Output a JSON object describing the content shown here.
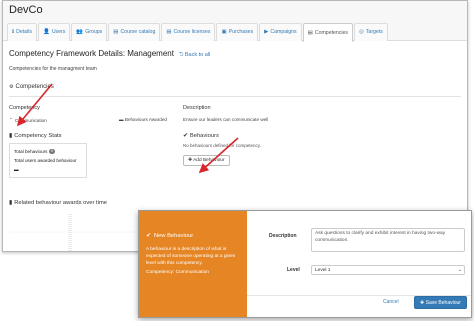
{
  "app": {
    "org_name": "DevCo"
  },
  "tabs": [
    {
      "label": "Details",
      "icon": "info-icon",
      "glyph": "ℹ"
    },
    {
      "label": "Users",
      "icon": "user-icon",
      "glyph": "👤"
    },
    {
      "label": "Groups",
      "icon": "group-icon",
      "glyph": "👥"
    },
    {
      "label": "Course catalog",
      "icon": "catalog-icon",
      "glyph": "▤"
    },
    {
      "label": "Course licenses",
      "icon": "license-icon",
      "glyph": "▤"
    },
    {
      "label": "Purchases",
      "icon": "purchase-icon",
      "glyph": "▣"
    },
    {
      "label": "Campaigns",
      "icon": "campaign-icon",
      "glyph": "▶"
    },
    {
      "label": "Competencies",
      "icon": "competency-icon",
      "glyph": "▤",
      "active": true
    },
    {
      "label": "Targets",
      "icon": "target-icon",
      "glyph": "◎"
    }
  ],
  "page": {
    "title": "Competency Framework Details: Management",
    "back_link": "Back to all",
    "subtitle": "Competencies for the managment team",
    "competencies_heading": "Competencies"
  },
  "table": {
    "col_competency": "Competency",
    "col_description": "Description",
    "row": {
      "name": "Communication",
      "awarded": "Behaviours Awarded",
      "description": "Ensure our leaders can communicate well"
    }
  },
  "stats": {
    "heading": "Competency Stats",
    "total_behaviours_label": "Total behaviours",
    "total_behaviours_count": "0",
    "total_users_label": "Total users awarded behaviour"
  },
  "behaviours": {
    "heading": "Behaviours",
    "empty_text": "No behaviours defined for competency.",
    "add_button": "Add Behaviour"
  },
  "chart": {
    "heading": "Related behaviour awards over time"
  },
  "modal": {
    "side_title": "New Behaviour",
    "side_desc": "A behaviour is a description of what is expected of someone operating at a given level with this competency.",
    "side_competency": "Competency: Communication",
    "description_label": "Description",
    "description_value": "Ask questions to clarify and exhibit interest in having two-way communication.",
    "level_label": "Level",
    "level_value": "Level 1",
    "cancel": "Cancel",
    "save": "Save Behaviour"
  },
  "colors": {
    "accent": "#e58524",
    "primary": "#337ab7",
    "arrow": "#d9262c"
  }
}
